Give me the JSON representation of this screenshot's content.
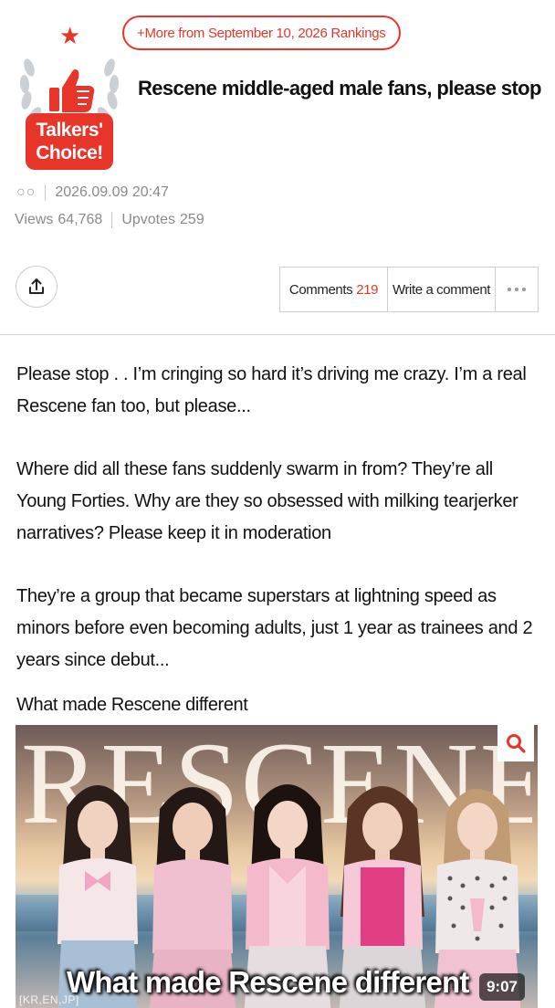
{
  "colors": {
    "accent": "#e8352a",
    "text": "#111111",
    "muted": "#8a8a8a",
    "border": "#cfcfcf"
  },
  "badge": {
    "line1": "Talkers'",
    "line2": "Choice!",
    "star_icon": "star-icon",
    "thumbs_icon": "thumbs-up-icon"
  },
  "ranking_link": {
    "label": "+More from September 10, 2026 Rankings"
  },
  "post": {
    "title": "Rescene middle-aged male fans, please stop",
    "author": "○○",
    "datetime": "2026.09.09 20:47",
    "views_label": "Views",
    "views": "64,768",
    "upvotes_label": "Upvotes",
    "upvotes": "259"
  },
  "actions": {
    "share_icon": "share-icon",
    "comments_label": "Comments",
    "comments_count": "219",
    "write_comment_label": "Write a comment",
    "more_icon": "more-icon"
  },
  "body": {
    "paragraphs": [
      "Please stop . . I’m cringing so hard it’s driving me crazy. I’m a real Rescene fan too, but please...",
      "Where did all these fans suddenly swarm in from? They’re all Young Forties. Why are they so obsessed with milking tearjerker narratives? Please keep it in moderation",
      "They’re a group that became superstars at lightning speed as minors before even becoming adults, just 1 year as trainees and 2 years since debut..."
    ],
    "caption": "What made Rescene different"
  },
  "video": {
    "background_word": "RESCENE",
    "title": "What made Rescene different",
    "languages": "[KR,EN,JP]",
    "duration": "9:07",
    "search_icon": "search-icon"
  }
}
